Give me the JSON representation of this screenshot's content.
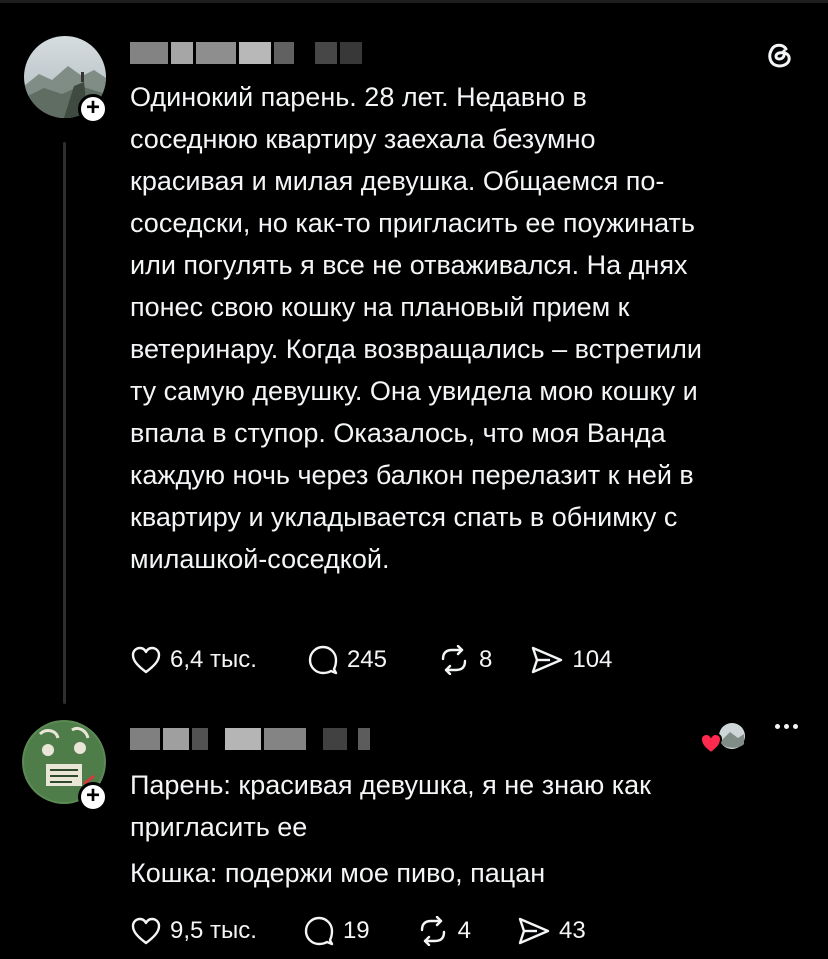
{
  "post": {
    "text": "Одинокий парень. 28 лет. Недавно в\nсоседнюю квартиру заехала безумно\nкрасивая и милая девушка. Общаемся по-\nсоседски, но как-то пригласить ее поужинать\nили погулять я все не отваживался. На днях\nпонес свою кошку на плановый прием к\nветеринару. Когда возвращались – встретили\nту самую девушку. Она увидела мою кошку и\nвпала в ступор. Оказалось, что моя Ванда\nкаждую ночь через балкон перелазит к ней в\nквартиру и укладывается спать в обнимку с\nмилашкой-соседкой.",
    "likes": "6,4 тыс.",
    "comments": "245",
    "reposts": "8",
    "shares": "104"
  },
  "reply": {
    "line1": "Парень: красивая девушка, я не знаю как",
    "line2": "пригласить ее",
    "line3": "Кошка: подержи мое пиво, пацан",
    "likes": "9,5 тыс.",
    "comments": "19",
    "reposts": "4",
    "shares": "43"
  },
  "icons": {
    "like": "heart-icon",
    "comment": "comment-bubble-icon",
    "repost": "repost-icon",
    "share": "send-icon",
    "app": "threads-logo-icon",
    "more": "more-dots-icon"
  },
  "colors": {
    "background": "#000000",
    "text": "#f3f5f7",
    "heart_badge": "#ff2a4d"
  }
}
